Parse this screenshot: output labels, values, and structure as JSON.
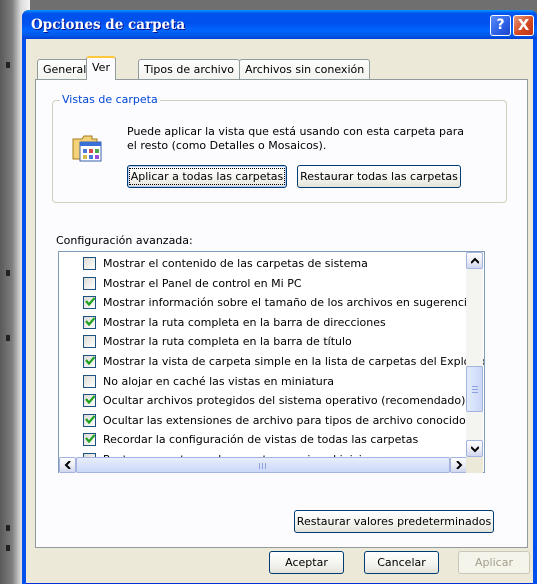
{
  "window": {
    "title": "Opciones de carpeta",
    "help_glyph": "?",
    "close_glyph": "X"
  },
  "tabs": [
    {
      "label": "General",
      "active": false
    },
    {
      "label": "Ver",
      "active": true
    },
    {
      "label": "Tipos de archivo",
      "active": false
    },
    {
      "label": "Archivos sin conexión",
      "active": false
    }
  ],
  "folder_views": {
    "legend": "Vistas de carpeta",
    "icon": "folder-view-icon",
    "description": "Puede aplicar la vista que está usando con esta carpeta para el resto (como Detalles o Mosaicos).",
    "apply_all_label": "Aplicar a todas las carpetas",
    "reset_all_label": "Restaurar todas las carpetas"
  },
  "advanced": {
    "label": "Configuración avanzada:",
    "items": [
      {
        "label": "Mostrar el contenido de las carpetas de sistema",
        "checked": false
      },
      {
        "label": "Mostrar el Panel de control en Mi PC",
        "checked": false
      },
      {
        "label": "Mostrar información sobre el tamaño de los archivos en sugerencias",
        "checked": true
      },
      {
        "label": "Mostrar la ruta completa en la barra de direcciones",
        "checked": true
      },
      {
        "label": "Mostrar la ruta completa en la barra de título",
        "checked": false
      },
      {
        "label": "Mostrar la vista de carpeta simple en la lista de carpetas del Explorador",
        "checked": true
      },
      {
        "label": "No alojar en caché las vistas en miniatura",
        "checked": false
      },
      {
        "label": "Ocultar archivos protegidos del sistema operativo (recomendado)",
        "checked": true
      },
      {
        "label": "Ocultar las extensiones de archivo para tipos de archivo conocidos",
        "checked": true
      },
      {
        "label": "Recordar la configuración de vistas de todas las carpetas",
        "checked": true
      },
      {
        "label": "Restaurar ventanas de carpetas previas al inicio",
        "checked": false
      }
    ],
    "restore_defaults_label": "Restaurar valores predeterminados"
  },
  "footer": {
    "ok_label": "Aceptar",
    "cancel_label": "Cancelar",
    "apply_label": "Aplicar"
  },
  "colors": {
    "titlebar": "#0050ee",
    "group_legend": "#0046d5",
    "check_green": "#21a121",
    "dialog_bg": "#ece9d8"
  }
}
